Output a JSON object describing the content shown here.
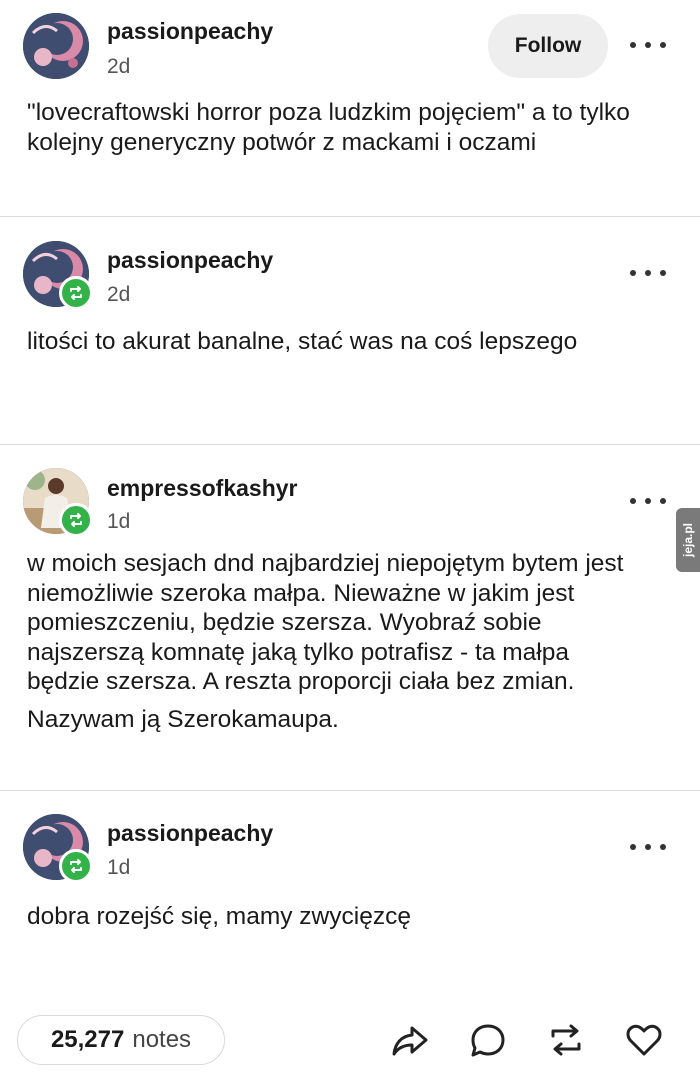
{
  "posts": [
    {
      "username": "passionpeachy",
      "time": "2d",
      "follow_label": "Follow",
      "paragraphs": [
        "\"lovecraftowski horror poza ludzkim pojęciem\" a to tylko kolejny generyczny potwór z mackami i oczami"
      ]
    },
    {
      "username": "passionpeachy",
      "time": "2d",
      "paragraphs": [
        "litości to akurat banalne, stać was na coś lepszego"
      ]
    },
    {
      "username": "empressofkashyr",
      "time": "1d",
      "paragraphs": [
        "w moich sesjach dnd najbardziej niepojętym bytem jest niemożliwie szeroka małpa. Nieważne w jakim jest pomieszczeniu, będzie szersza. Wyobraź sobie najszerszą komnatę jaką tylko potrafisz - ta małpa będzie szersza. A reszta proporcji ciała bez zmian.",
        "Nazywam ją Szerokamaupa."
      ]
    },
    {
      "username": "passionpeachy",
      "time": "1d",
      "paragraphs": [
        "dobra rozejść się, mamy zwycięzcę"
      ]
    }
  ],
  "footer": {
    "notes_count": "25,277",
    "notes_label": "notes"
  },
  "watermark": "jeja.pl",
  "colors": {
    "reblog_green": "#34b24a",
    "divider": "#dcdcdc",
    "follow_bg": "#eeeeee"
  },
  "icons": [
    "more-icon",
    "reblog-icon",
    "share-icon",
    "reply-icon",
    "like-icon"
  ]
}
